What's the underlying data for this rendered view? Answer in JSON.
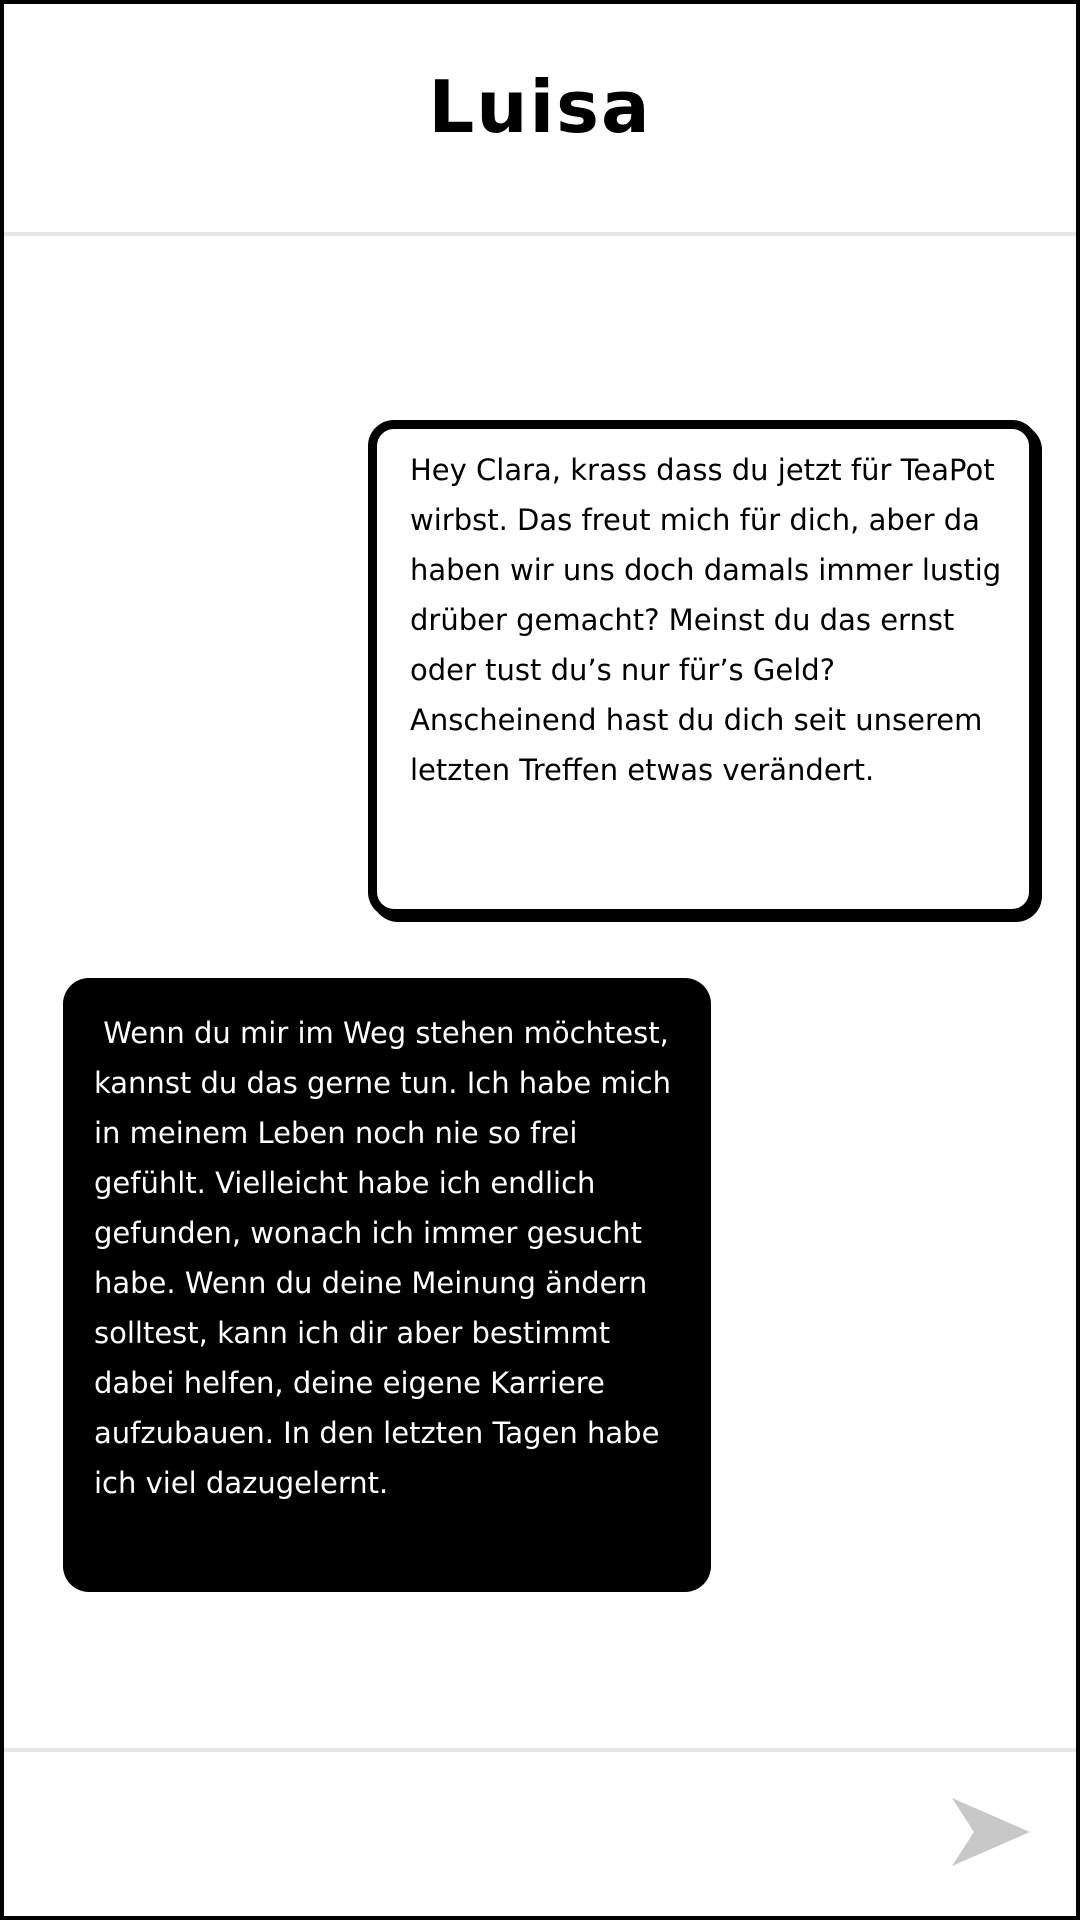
{
  "header": {
    "contact_name": "Luisa"
  },
  "messages": [
    {
      "direction": "incoming",
      "text": "Hey Clara, krass dass du jetzt für TeaPot wirbst. Das freut mich für dich, aber da haben wir uns doch damals immer lustig drüber gemacht? Meinst du das ernst oder tust du’s nur für’s Geld? Anscheinend hast du dich seit unserem letzten Treffen etwas verändert."
    },
    {
      "direction": "outgoing",
      "text": " Wenn du mir im Weg stehen möchtest, kannst du das gerne tun. Ich habe mich in meinem Leben noch nie so frei gefühlt. Vielleicht habe ich endlich gefunden, wonach ich immer gesucht habe. Wenn du deine Meinung ändern solltest, kann ich dir aber bestimmt dabei helfen, deine eigene Karriere aufzubauen. In den letzten Tagen habe ich viel dazugelernt."
    }
  ],
  "footer": {
    "send_icon": "send-arrow-icon",
    "send_icon_color": "#c8c8c8"
  },
  "colors": {
    "border": "#000000",
    "divider": "#e6e6e6",
    "incoming_bg": "#ffffff",
    "outgoing_bg": "#000000"
  }
}
